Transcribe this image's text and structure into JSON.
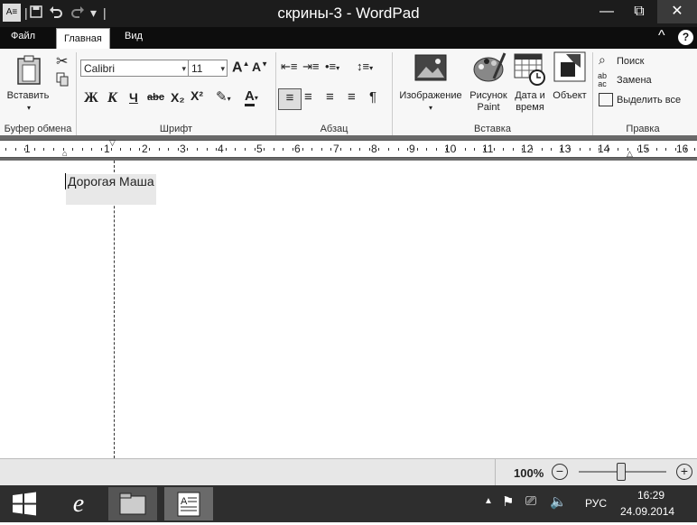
{
  "window": {
    "title": "скрины-3 - WordPad",
    "qat": {
      "save_icon": "save-icon",
      "undo_icon": "undo-icon",
      "redo_icon": "redo-icon",
      "customize": "▾"
    },
    "controls": {
      "minimize": "—",
      "maximize": "⧉",
      "close": "✕"
    }
  },
  "tabs": {
    "file": "Файл",
    "home": "Главная",
    "view": "Вид"
  },
  "ribbon": {
    "clipboard": {
      "label": "Буфер обмена",
      "paste": "Вставить"
    },
    "font": {
      "label": "Шрифт",
      "family": "Calibri",
      "size": "11",
      "bold": "Ж",
      "italic": "К",
      "underline": "Ч",
      "strike": "abc",
      "subscript": "X₂",
      "superscript": "X²"
    },
    "paragraph": {
      "label": "Абзац"
    },
    "insert": {
      "label": "Вставка",
      "image": "Изображение",
      "paint": "Рисунок Paint",
      "paint_l1": "Рисунок",
      "paint_l2": "Paint",
      "datetime_l1": "Дата и",
      "datetime_l2": "время",
      "object": "Объект"
    },
    "edit": {
      "label": "Правка",
      "find": "Поиск",
      "replace": "Замена",
      "select_all": "Выделить все"
    }
  },
  "ruler": {
    "numbers": [
      "1",
      "1",
      "2",
      "3",
      "4",
      "5",
      "6",
      "7",
      "8",
      "9",
      "10",
      "11",
      "12",
      "13",
      "14",
      "15",
      "16"
    ]
  },
  "document": {
    "text": "Дорогая Маша"
  },
  "status": {
    "zoom": "100%"
  },
  "taskbar": {
    "language": "РУС",
    "time": "16:29",
    "date": "24.09.2014"
  }
}
